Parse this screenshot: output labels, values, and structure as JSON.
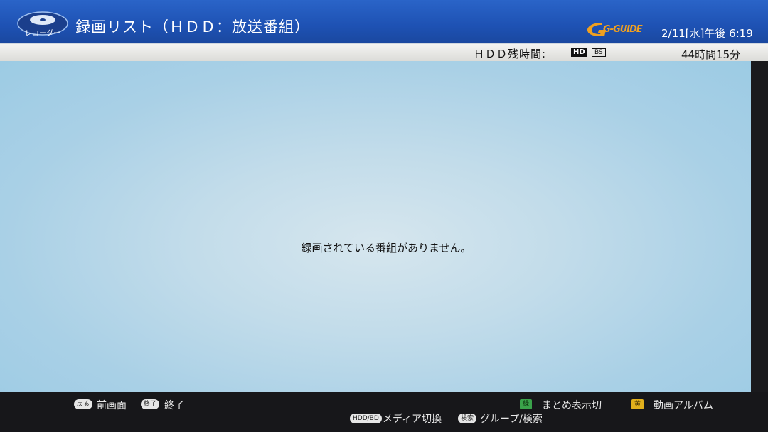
{
  "header": {
    "logo_label": "レコーダー",
    "title": "録画リスト（ＨＤＤ：放送番組）",
    "gguide_label": "G-GUIDE",
    "datetime": "2/11[水]午後 6:19"
  },
  "status": {
    "label": "ＨＤＤ残時間:",
    "badge_hd": "HD",
    "badge_bs": "BS",
    "remaining": "44時間15分"
  },
  "main": {
    "empty_message": "録画されている番組がありません。"
  },
  "footer": {
    "back_key": "戻る",
    "back_label": "前画面",
    "end_key": "終了",
    "end_label": "終了",
    "green_key": "緑",
    "green_label": "まとめ表示切",
    "yellow_key": "黄",
    "yellow_label": "動画アルバム",
    "media_key": "HDD/BD",
    "media_label": "メディア切換",
    "search_key": "検索",
    "search_label": "グループ/検索"
  },
  "colors": {
    "header_blue": "#1e52b4",
    "main_light_blue": "#c2dcea",
    "key_green": "#3aa24a",
    "key_yellow": "#e2b01c",
    "gguide_orange": "#f0a020"
  },
  "icons": {
    "recorder": "disc-icon",
    "gguide": "gguide-logo-icon"
  }
}
